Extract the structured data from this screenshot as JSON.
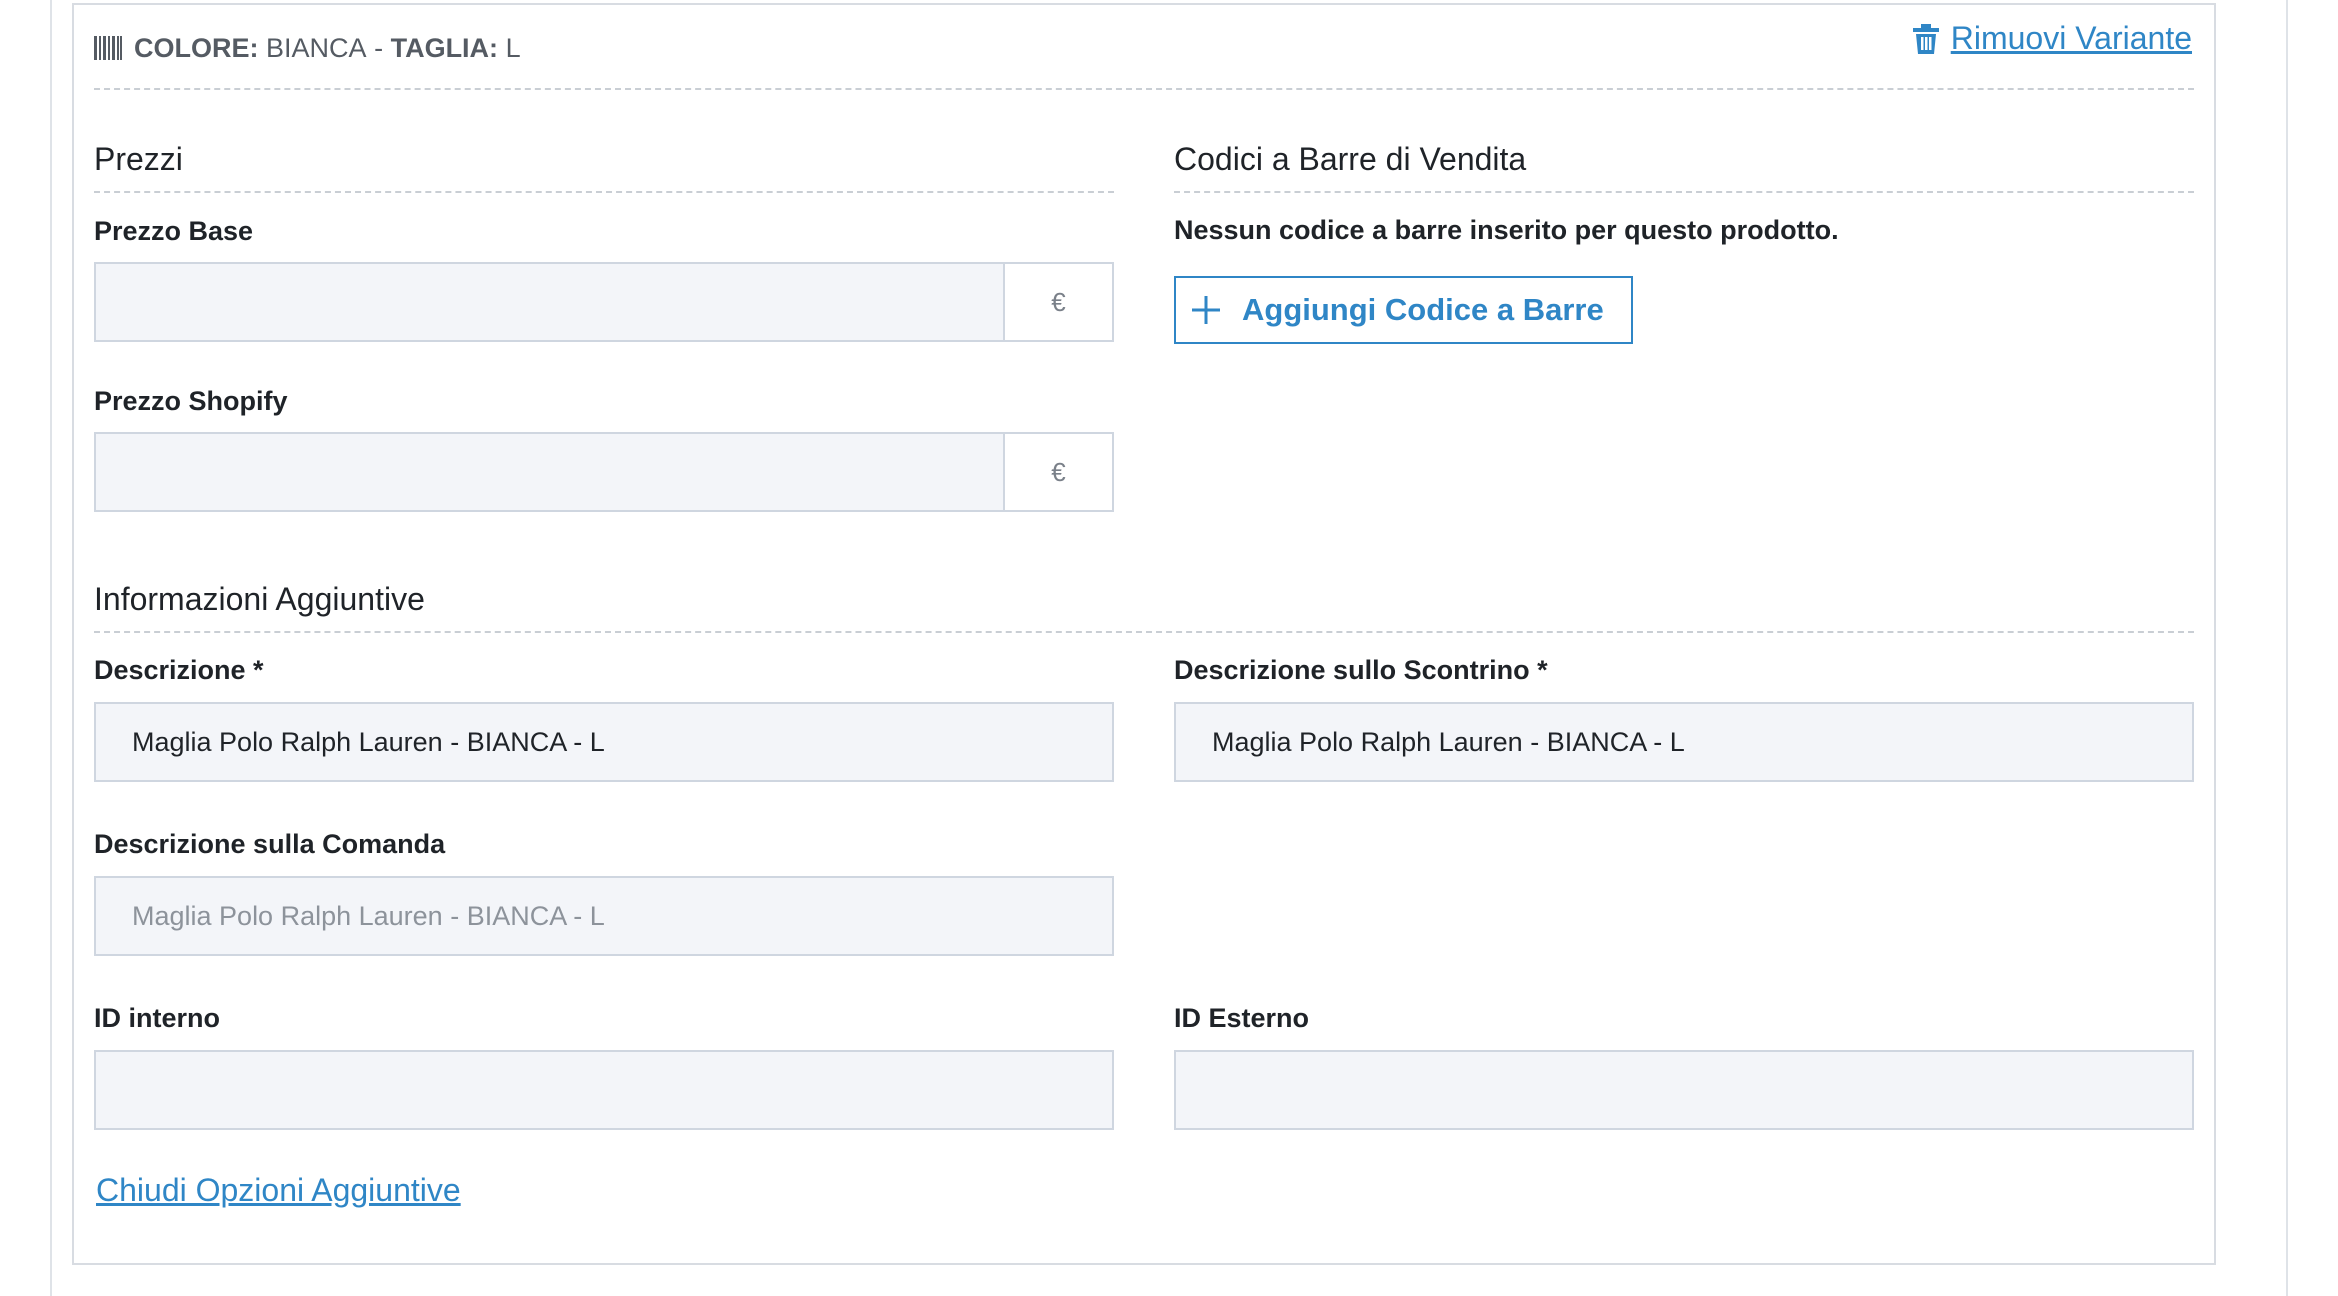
{
  "variant": {
    "color_label": "COLORE:",
    "color_value": "BIANCA",
    "separator": "-",
    "size_label": "TAGLIA:",
    "size_value": "L",
    "icon": "barcode-icon",
    "remove_label": "Rimuovi Variante",
    "remove_icon": "trash-icon"
  },
  "prices": {
    "title": "Prezzi",
    "base_label": "Prezzo Base",
    "base_value": "",
    "base_currency": "€",
    "shopify_label": "Prezzo Shopify",
    "shopify_value": "",
    "shopify_currency": "€"
  },
  "barcodes": {
    "title": "Codici a Barre di Vendita",
    "empty_message": "Nessun codice a barre inserito per questo prodotto.",
    "add_label": "Aggiungi Codice a Barre",
    "add_icon": "plus-icon"
  },
  "additional": {
    "title": "Informazioni Aggiuntive",
    "description_label": "Descrizione *",
    "description_value": "Maglia Polo Ralph Lauren - BIANCA - L",
    "receipt_label": "Descrizione sullo Scontrino *",
    "receipt_value": "Maglia Polo Ralph Lauren - BIANCA - L",
    "order_label": "Descrizione sulla Comanda",
    "order_placeholder": "Maglia Polo Ralph Lauren - BIANCA - L",
    "internal_id_label": "ID interno",
    "internal_id_value": "",
    "external_id_label": "ID Esterno",
    "external_id_value": "",
    "close_label": "Chiudi Opzioni Aggiuntive"
  },
  "colors": {
    "accent": "#2f86c6",
    "input_bg": "#f3f5f9",
    "input_border": "#cfd6e0"
  }
}
